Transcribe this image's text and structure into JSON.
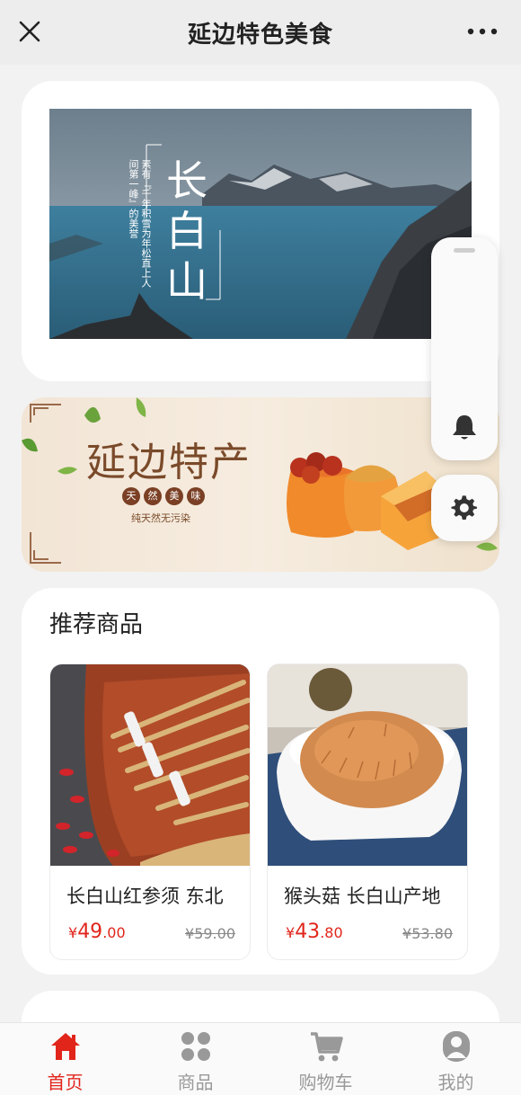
{
  "header": {
    "title": "延边特色美食"
  },
  "banner1": {
    "title": "长白山",
    "subtitle": "素有『千年积雪为年松直上人间第一峰』的美誉"
  },
  "banner2": {
    "title": "延边特产",
    "badges": [
      "天",
      "然",
      "美",
      "味"
    ],
    "subtitle": "纯天然无污染"
  },
  "recommend": {
    "title": "推荐商品",
    "products": [
      {
        "name": "长白山红参须 东北",
        "price_symbol": "¥",
        "price_int": "49",
        "price_dec": ".00",
        "old_price": "¥59.00"
      },
      {
        "name": "猴头菇 长白山产地",
        "price_symbol": "¥",
        "price_int": "43",
        "price_dec": ".80",
        "old_price": "¥53.80"
      }
    ]
  },
  "tabbar": {
    "items": [
      {
        "label": "首页",
        "icon": "home-icon",
        "active": true
      },
      {
        "label": "商品",
        "icon": "grid-icon",
        "active": false
      },
      {
        "label": "购物车",
        "icon": "cart-icon",
        "active": false
      },
      {
        "label": "我的",
        "icon": "user-icon",
        "active": false
      }
    ]
  },
  "colors": {
    "accent": "#e1251b",
    "inactive": "#999999"
  }
}
